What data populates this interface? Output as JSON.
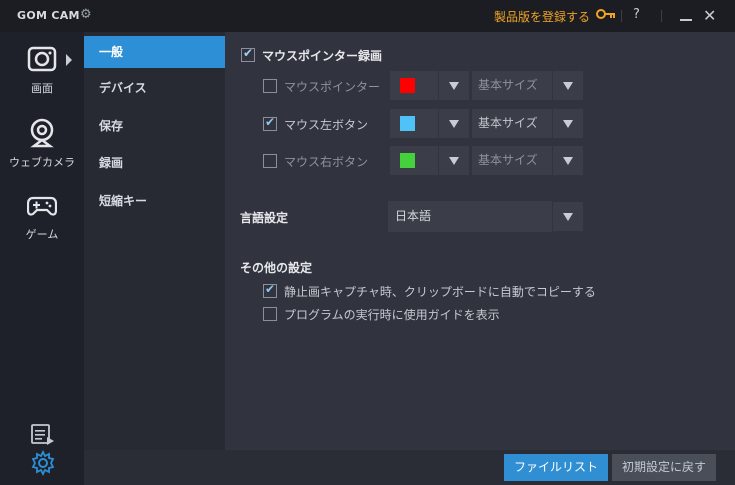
{
  "titlebar": {
    "app_name": "GOM CAM",
    "register_label": "製品版を登録する",
    "help_label": "?",
    "close_label": "✕"
  },
  "rail": {
    "items": [
      {
        "label": "画面"
      },
      {
        "label": "ウェブカメラ"
      },
      {
        "label": "ゲーム"
      }
    ]
  },
  "categories": [
    {
      "label": "一般"
    },
    {
      "label": "デバイス"
    },
    {
      "label": "保存"
    },
    {
      "label": "録画"
    },
    {
      "label": "短縮キー"
    }
  ],
  "mouse": {
    "header_label": "マウスポインター録画",
    "rows": [
      {
        "label": "マウスポインター",
        "checked": false,
        "color": "#ff0000",
        "size": "基本サイズ"
      },
      {
        "label": "マウス左ボタン",
        "checked": true,
        "color": "#4fc3f7",
        "size": "基本サイズ"
      },
      {
        "label": "マウス右ボタン",
        "checked": false,
        "color": "#44d13c",
        "size": "基本サイズ"
      }
    ]
  },
  "language": {
    "label": "言語設定",
    "value": "日本語"
  },
  "other": {
    "header": "その他の設定",
    "option1": "静止画キャプチャ時、クリップボードに自動でコピーする",
    "option2": "プログラムの実行時に使用ガイドを表示"
  },
  "buttons": {
    "file_list": "ファイルリスト",
    "reset": "初期設定に戻す"
  },
  "colors": {
    "accent": "#2d8fd6",
    "register": "#f0a424"
  }
}
